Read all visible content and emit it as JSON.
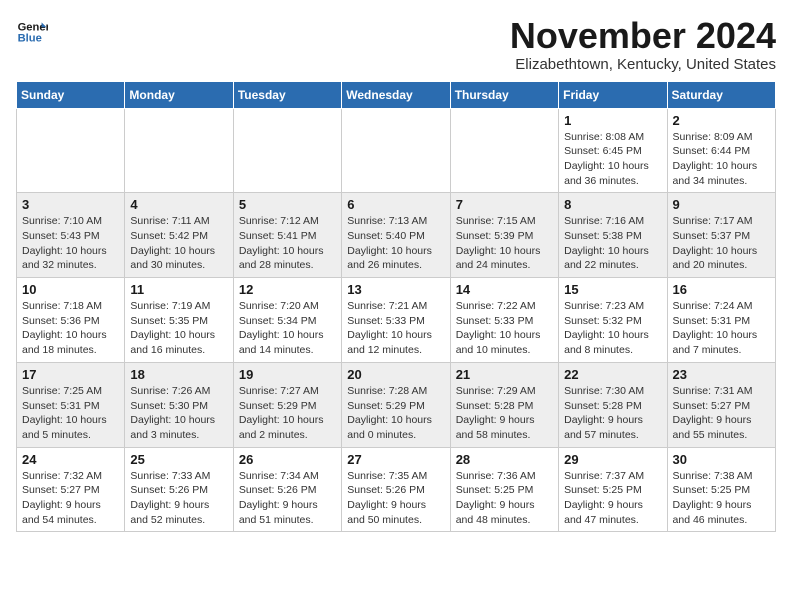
{
  "logo": {
    "text_general": "General",
    "text_blue": "Blue"
  },
  "header": {
    "month": "November 2024",
    "location": "Elizabethtown, Kentucky, United States"
  },
  "weekdays": [
    "Sunday",
    "Monday",
    "Tuesday",
    "Wednesday",
    "Thursday",
    "Friday",
    "Saturday"
  ],
  "weeks": [
    {
      "days": [
        {
          "num": "",
          "info": ""
        },
        {
          "num": "",
          "info": ""
        },
        {
          "num": "",
          "info": ""
        },
        {
          "num": "",
          "info": ""
        },
        {
          "num": "",
          "info": ""
        },
        {
          "num": "1",
          "info": "Sunrise: 8:08 AM\nSunset: 6:45 PM\nDaylight: 10 hours and 36 minutes."
        },
        {
          "num": "2",
          "info": "Sunrise: 8:09 AM\nSunset: 6:44 PM\nDaylight: 10 hours and 34 minutes."
        }
      ]
    },
    {
      "days": [
        {
          "num": "3",
          "info": "Sunrise: 7:10 AM\nSunset: 5:43 PM\nDaylight: 10 hours and 32 minutes."
        },
        {
          "num": "4",
          "info": "Sunrise: 7:11 AM\nSunset: 5:42 PM\nDaylight: 10 hours and 30 minutes."
        },
        {
          "num": "5",
          "info": "Sunrise: 7:12 AM\nSunset: 5:41 PM\nDaylight: 10 hours and 28 minutes."
        },
        {
          "num": "6",
          "info": "Sunrise: 7:13 AM\nSunset: 5:40 PM\nDaylight: 10 hours and 26 minutes."
        },
        {
          "num": "7",
          "info": "Sunrise: 7:15 AM\nSunset: 5:39 PM\nDaylight: 10 hours and 24 minutes."
        },
        {
          "num": "8",
          "info": "Sunrise: 7:16 AM\nSunset: 5:38 PM\nDaylight: 10 hours and 22 minutes."
        },
        {
          "num": "9",
          "info": "Sunrise: 7:17 AM\nSunset: 5:37 PM\nDaylight: 10 hours and 20 minutes."
        }
      ]
    },
    {
      "days": [
        {
          "num": "10",
          "info": "Sunrise: 7:18 AM\nSunset: 5:36 PM\nDaylight: 10 hours and 18 minutes."
        },
        {
          "num": "11",
          "info": "Sunrise: 7:19 AM\nSunset: 5:35 PM\nDaylight: 10 hours and 16 minutes."
        },
        {
          "num": "12",
          "info": "Sunrise: 7:20 AM\nSunset: 5:34 PM\nDaylight: 10 hours and 14 minutes."
        },
        {
          "num": "13",
          "info": "Sunrise: 7:21 AM\nSunset: 5:33 PM\nDaylight: 10 hours and 12 minutes."
        },
        {
          "num": "14",
          "info": "Sunrise: 7:22 AM\nSunset: 5:33 PM\nDaylight: 10 hours and 10 minutes."
        },
        {
          "num": "15",
          "info": "Sunrise: 7:23 AM\nSunset: 5:32 PM\nDaylight: 10 hours and 8 minutes."
        },
        {
          "num": "16",
          "info": "Sunrise: 7:24 AM\nSunset: 5:31 PM\nDaylight: 10 hours and 7 minutes."
        }
      ]
    },
    {
      "days": [
        {
          "num": "17",
          "info": "Sunrise: 7:25 AM\nSunset: 5:31 PM\nDaylight: 10 hours and 5 minutes."
        },
        {
          "num": "18",
          "info": "Sunrise: 7:26 AM\nSunset: 5:30 PM\nDaylight: 10 hours and 3 minutes."
        },
        {
          "num": "19",
          "info": "Sunrise: 7:27 AM\nSunset: 5:29 PM\nDaylight: 10 hours and 2 minutes."
        },
        {
          "num": "20",
          "info": "Sunrise: 7:28 AM\nSunset: 5:29 PM\nDaylight: 10 hours and 0 minutes."
        },
        {
          "num": "21",
          "info": "Sunrise: 7:29 AM\nSunset: 5:28 PM\nDaylight: 9 hours and 58 minutes."
        },
        {
          "num": "22",
          "info": "Sunrise: 7:30 AM\nSunset: 5:28 PM\nDaylight: 9 hours and 57 minutes."
        },
        {
          "num": "23",
          "info": "Sunrise: 7:31 AM\nSunset: 5:27 PM\nDaylight: 9 hours and 55 minutes."
        }
      ]
    },
    {
      "days": [
        {
          "num": "24",
          "info": "Sunrise: 7:32 AM\nSunset: 5:27 PM\nDaylight: 9 hours and 54 minutes."
        },
        {
          "num": "25",
          "info": "Sunrise: 7:33 AM\nSunset: 5:26 PM\nDaylight: 9 hours and 52 minutes."
        },
        {
          "num": "26",
          "info": "Sunrise: 7:34 AM\nSunset: 5:26 PM\nDaylight: 9 hours and 51 minutes."
        },
        {
          "num": "27",
          "info": "Sunrise: 7:35 AM\nSunset: 5:26 PM\nDaylight: 9 hours and 50 minutes."
        },
        {
          "num": "28",
          "info": "Sunrise: 7:36 AM\nSunset: 5:25 PM\nDaylight: 9 hours and 48 minutes."
        },
        {
          "num": "29",
          "info": "Sunrise: 7:37 AM\nSunset: 5:25 PM\nDaylight: 9 hours and 47 minutes."
        },
        {
          "num": "30",
          "info": "Sunrise: 7:38 AM\nSunset: 5:25 PM\nDaylight: 9 hours and 46 minutes."
        }
      ]
    }
  ]
}
